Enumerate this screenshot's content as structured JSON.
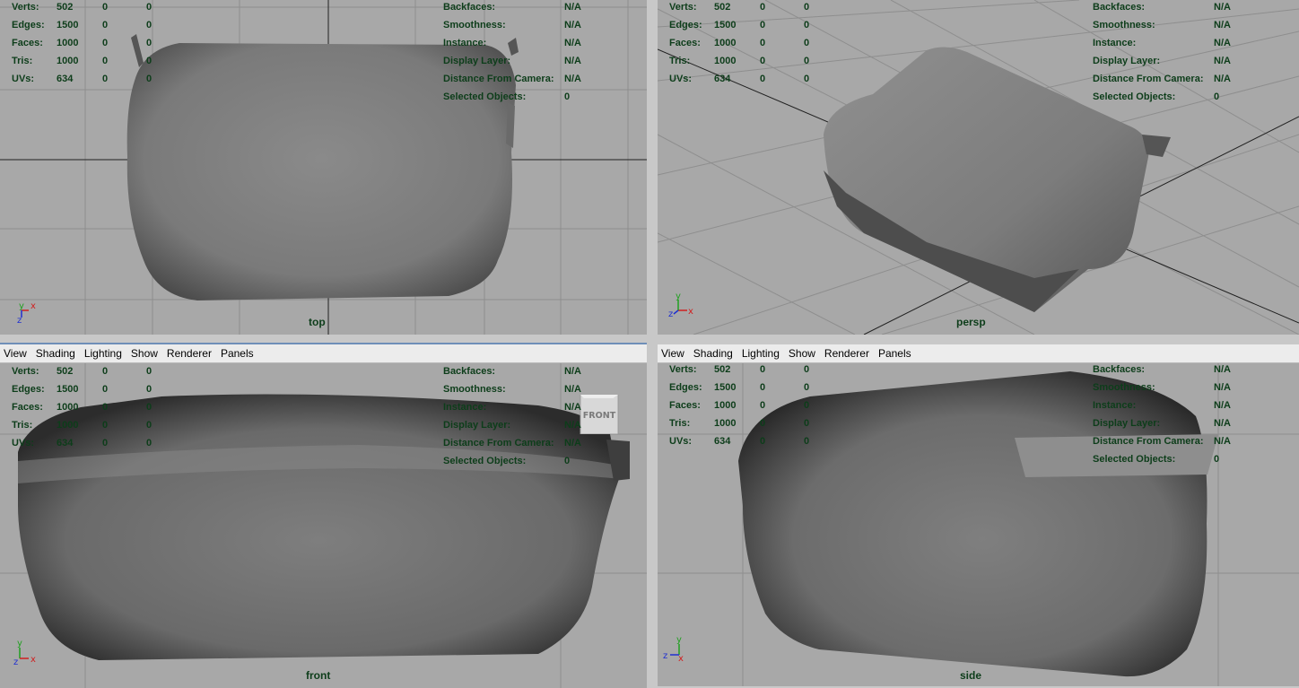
{
  "menus": [
    "View",
    "Shading",
    "Lighting",
    "Show",
    "Renderer",
    "Panels"
  ],
  "hud_left": [
    {
      "label": "Verts:",
      "v1": "502",
      "v2": "0",
      "v3": "0"
    },
    {
      "label": "Edges:",
      "v1": "1500",
      "v2": "0",
      "v3": "0"
    },
    {
      "label": "Faces:",
      "v1": "1000",
      "v2": "0",
      "v3": "0"
    },
    {
      "label": "Tris:",
      "v1": "1000",
      "v2": "0",
      "v3": "0"
    },
    {
      "label": "UVs:",
      "v1": "634",
      "v2": "0",
      "v3": "0"
    }
  ],
  "hud_right": [
    {
      "label": "Backfaces:",
      "value": "N/A"
    },
    {
      "label": "Smoothness:",
      "value": "N/A"
    },
    {
      "label": "Instance:",
      "value": "N/A"
    },
    {
      "label": "Display Layer:",
      "value": "N/A"
    },
    {
      "label": "Distance From Camera:",
      "value": "N/A"
    },
    {
      "label": "Selected Objects:",
      "value": "0"
    }
  ],
  "viewports": [
    {
      "id": "top",
      "camera": "top",
      "has_menu": false
    },
    {
      "id": "persp",
      "camera": "persp",
      "has_menu": false
    },
    {
      "id": "front",
      "camera": "front",
      "has_menu": true,
      "view_cube_label": "FRONT"
    },
    {
      "id": "side",
      "camera": "side",
      "has_menu": true
    }
  ],
  "axes": {
    "x": "x",
    "y": "y",
    "z": "z"
  },
  "colors": {
    "viewport_bg": "#a8a8a8",
    "grid": "#8e8e8e",
    "grid_axis": "#202020",
    "hud_text": "#0d3d1a",
    "menubar_bg": "#ececec",
    "separator": "#c8c8c8",
    "active_border": "#6f8fb8"
  }
}
